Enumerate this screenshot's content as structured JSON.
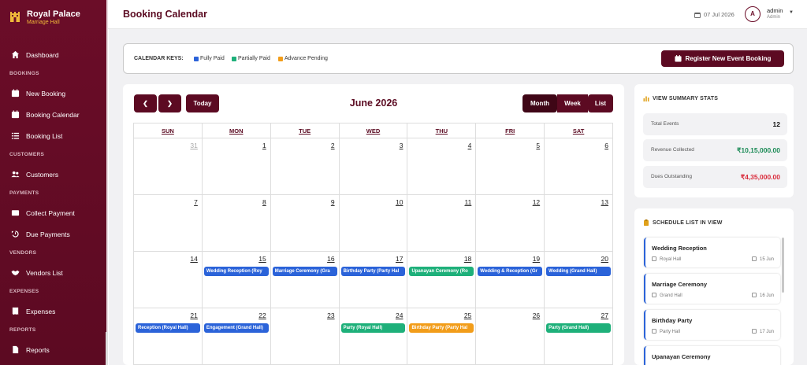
{
  "brand": {
    "name": "Royal Palace",
    "subtitle": "Marriage Hall"
  },
  "sidebar": {
    "dashboard": "Dashboard",
    "sections": {
      "bookings": "BOOKINGS",
      "customers": "CUSTOMERS",
      "payments": "PAYMENTS",
      "vendors": "VENDORS",
      "expenses": "EXPENSES",
      "reports": "REPORTS"
    },
    "items": {
      "new_booking": "New Booking",
      "booking_calendar": "Booking Calendar",
      "booking_list": "Booking List",
      "customers": "Customers",
      "collect_payment": "Collect Payment",
      "due_payments": "Due Payments",
      "vendors_list": "Vendors List",
      "expenses": "Expenses",
      "reports": "Reports"
    }
  },
  "header": {
    "title": "Booking Calendar",
    "date": "07 Jul 2026",
    "avatar_letter": "A",
    "user_name": "admin",
    "user_role": "Admin"
  },
  "keys": {
    "label": "CALENDAR KEYS:",
    "fully_paid": "Fully Paid",
    "partially_paid": "Partially Paid",
    "advance_pending": "Advance Pending",
    "register_button": "Register New Event Booking"
  },
  "colors": {
    "fully_paid": "#2b63d9",
    "partially_paid": "#1eb07a",
    "advance_pending": "#f29d1a",
    "brand": "#5c0a22"
  },
  "calendar": {
    "today_label": "Today",
    "title": "June 2026",
    "views": {
      "month": "Month",
      "week": "Week",
      "list": "List"
    },
    "weekdays": [
      "SUN",
      "MON",
      "TUE",
      "WED",
      "THU",
      "FRI",
      "SAT"
    ],
    "weeks": [
      [
        {
          "d": "31",
          "other": true,
          "events": []
        },
        {
          "d": "1",
          "events": []
        },
        {
          "d": "2",
          "events": []
        },
        {
          "d": "3",
          "events": []
        },
        {
          "d": "4",
          "events": []
        },
        {
          "d": "5",
          "events": []
        },
        {
          "d": "6",
          "events": []
        }
      ],
      [
        {
          "d": "7",
          "events": []
        },
        {
          "d": "8",
          "events": []
        },
        {
          "d": "9",
          "events": []
        },
        {
          "d": "10",
          "events": []
        },
        {
          "d": "11",
          "events": []
        },
        {
          "d": "12",
          "events": []
        },
        {
          "d": "13",
          "events": []
        }
      ],
      [
        {
          "d": "14",
          "events": []
        },
        {
          "d": "15",
          "events": [
            {
              "title": "Wedding Reception (Roy",
              "status": "fully_paid"
            }
          ]
        },
        {
          "d": "16",
          "events": [
            {
              "title": "Marriage Ceremony (Gra",
              "status": "fully_paid"
            }
          ]
        },
        {
          "d": "17",
          "events": [
            {
              "title": "Birthday Party (Party Hal",
              "status": "fully_paid"
            }
          ]
        },
        {
          "d": "18",
          "events": [
            {
              "title": "Upanayan Ceremony (Ro",
              "status": "partially_paid"
            }
          ]
        },
        {
          "d": "19",
          "events": [
            {
              "title": "Wedding & Reception (Gr",
              "status": "fully_paid"
            }
          ]
        },
        {
          "d": "20",
          "events": [
            {
              "title": "Wedding (Grand Hall)",
              "status": "fully_paid"
            }
          ]
        }
      ],
      [
        {
          "d": "21",
          "events": [
            {
              "title": "Reception (Royal Hall)",
              "status": "fully_paid"
            }
          ]
        },
        {
          "d": "22",
          "events": [
            {
              "title": "Engagement (Grand Hall)",
              "status": "fully_paid"
            }
          ]
        },
        {
          "d": "23",
          "events": []
        },
        {
          "d": "24",
          "events": [
            {
              "title": "Party (Royal Hall)",
              "status": "partially_paid"
            }
          ]
        },
        {
          "d": "25",
          "events": [
            {
              "title": "Birthday Party (Party Hal",
              "status": "advance_pending"
            }
          ]
        },
        {
          "d": "26",
          "events": []
        },
        {
          "d": "27",
          "events": [
            {
              "title": "Party (Grand Hall)",
              "status": "partially_paid"
            }
          ]
        }
      ]
    ]
  },
  "stats": {
    "heading": "VIEW SUMMARY STATS",
    "total_events_label": "Total Events",
    "total_events_value": "12",
    "revenue_label": "Revenue Collected",
    "revenue_value": "₹10,15,000.00",
    "dues_label": "Dues Outstanding",
    "dues_value": "₹4,35,000.00"
  },
  "schedule": {
    "heading": "SCHEDULE LIST IN VIEW",
    "items": [
      {
        "title": "Wedding Reception",
        "venue": "Royal Hall",
        "date": "15 Jun"
      },
      {
        "title": "Marriage Ceremony",
        "venue": "Grand Hall",
        "date": "16 Jun"
      },
      {
        "title": "Birthday Party",
        "venue": "Party Hall",
        "date": "17 Jun"
      },
      {
        "title": "Upanayan Ceremony",
        "venue": "",
        "date": ""
      }
    ]
  }
}
